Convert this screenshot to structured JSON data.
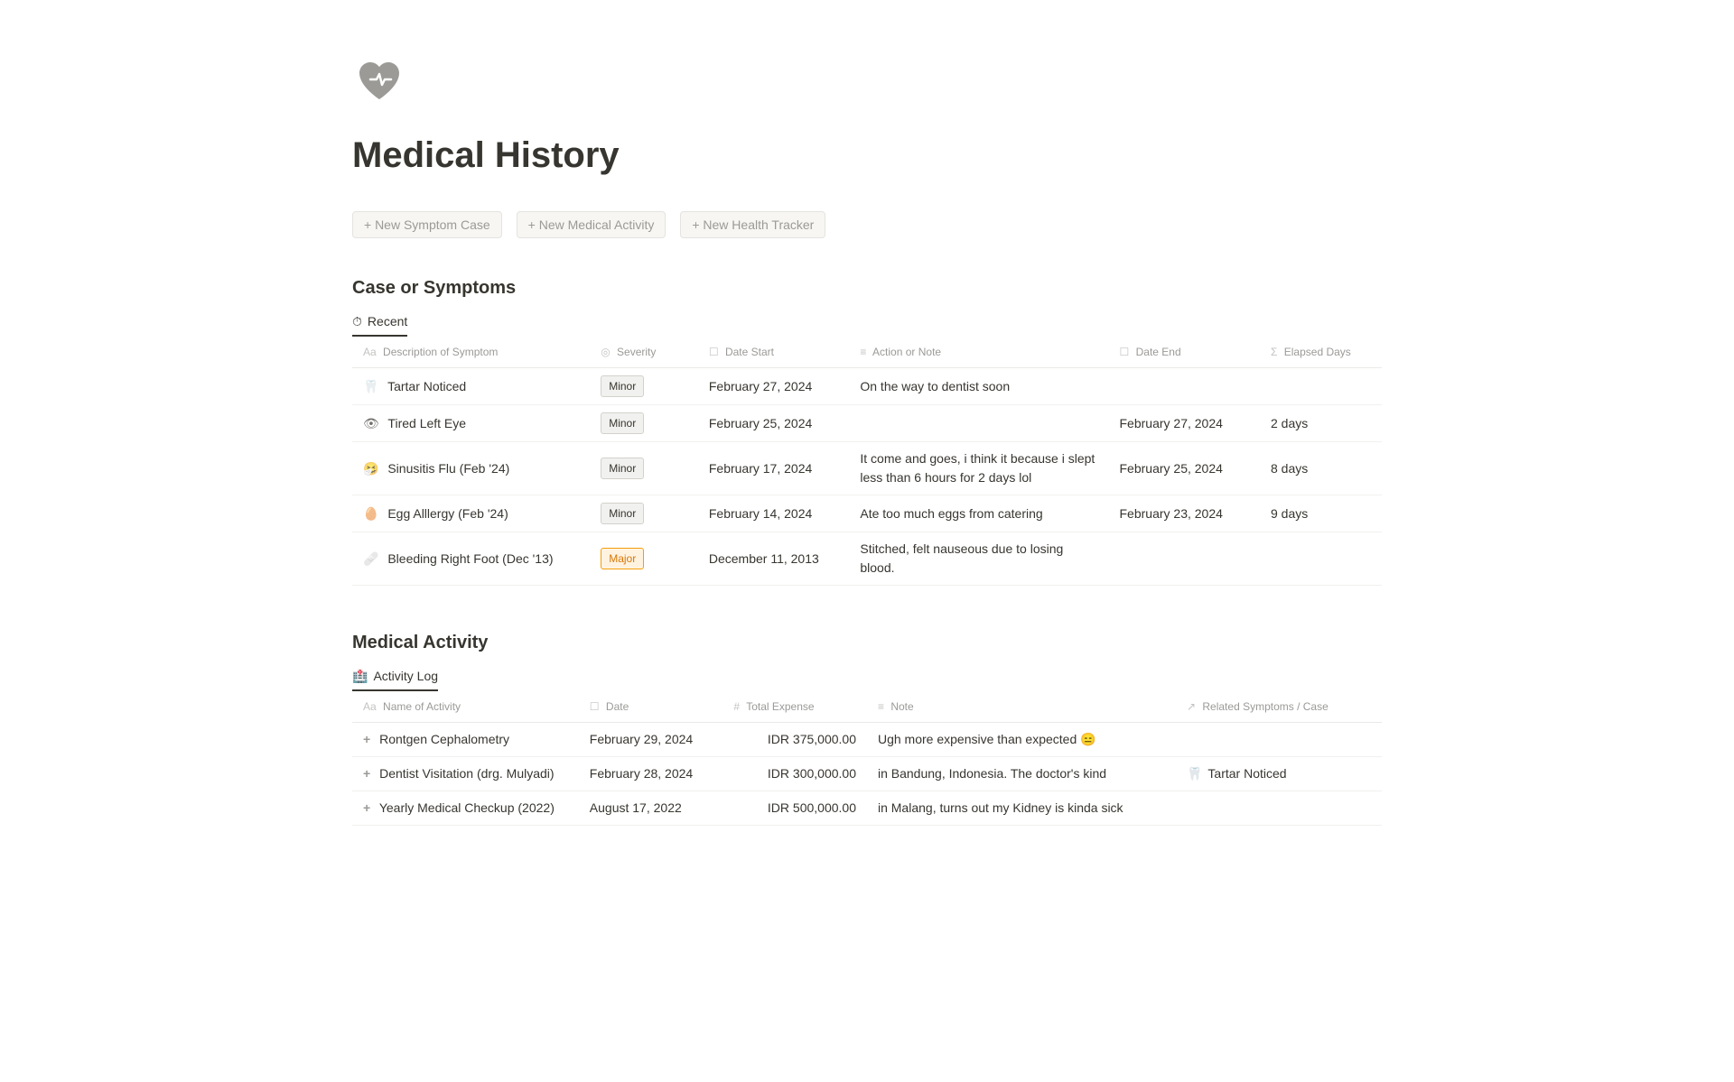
{
  "page": {
    "title": "Medical History",
    "logo_alt": "medical-history-icon"
  },
  "actions": {
    "new_symptom_label": "+ New Symptom Case",
    "new_medical_label": "+ New Medical Activity",
    "new_tracker_label": "+ New Health Tracker"
  },
  "symptoms_section": {
    "title": "Case or Symptoms",
    "tab_label": "Recent",
    "tab_icon": "⏱",
    "columns": [
      {
        "icon": "Aa",
        "label": "Description of Symptom"
      },
      {
        "icon": "◎",
        "label": "Severity"
      },
      {
        "icon": "☐",
        "label": "Date Start"
      },
      {
        "icon": "≡",
        "label": "Action or Note"
      },
      {
        "icon": "☐",
        "label": "Date End"
      },
      {
        "icon": "Σ",
        "label": "Elapsed Days"
      }
    ],
    "rows": [
      {
        "icon": "🦷",
        "description": "Tartar Noticed",
        "severity": "Minor",
        "severity_type": "minor",
        "date_start": "February 27, 2024",
        "action_note": "On the way to dentist soon",
        "date_end": "",
        "elapsed_days": ""
      },
      {
        "icon": "👁",
        "description": "Tired Left Eye",
        "severity": "Minor",
        "severity_type": "minor",
        "date_start": "February 25, 2024",
        "action_note": "",
        "date_end": "February 27, 2024",
        "elapsed_days": "2 days"
      },
      {
        "icon": "🤧",
        "description": "Sinusitis Flu (Feb '24)",
        "severity": "Minor",
        "severity_type": "minor",
        "date_start": "February 17, 2024",
        "action_note": "It come and goes, i think it because i slept less than 6 hours for 2 days lol",
        "date_end": "February 25, 2024",
        "elapsed_days": "8 days"
      },
      {
        "icon": "🥚",
        "description": "Egg Alllergy (Feb '24)",
        "severity": "Minor",
        "severity_type": "minor",
        "date_start": "February 14, 2024",
        "action_note": "Ate too much eggs from catering",
        "date_end": "February 23, 2024",
        "elapsed_days": "9 days"
      },
      {
        "icon": "🩹",
        "description": "Bleeding Right Foot (Dec '13)",
        "severity": "Major",
        "severity_type": "major",
        "date_start": "December 11, 2013",
        "action_note": "Stitched, felt nauseous due to losing blood.",
        "date_end": "",
        "elapsed_days": ""
      }
    ]
  },
  "activity_section": {
    "title": "Medical Activity",
    "tab_label": "Activity Log",
    "tab_icon": "🏥",
    "columns": [
      {
        "icon": "Aa",
        "label": "Name of Activity"
      },
      {
        "icon": "☐",
        "label": "Date"
      },
      {
        "icon": "#",
        "label": "Total Expense"
      },
      {
        "icon": "≡",
        "label": "Note"
      },
      {
        "icon": "↗",
        "label": "Related Symptoms / Case"
      }
    ],
    "rows": [
      {
        "icon": "+",
        "name": "Rontgen Cephalometry",
        "date": "February 29, 2024",
        "expense": "IDR 375,000.00",
        "note": "Ugh more expensive than expected 😑",
        "related": ""
      },
      {
        "icon": "+",
        "name": "Dentist Visitation (drg. Mulyadi)",
        "date": "February 28, 2024",
        "expense": "IDR 300,000.00",
        "note": "in Bandung, Indonesia. The doctor's kind",
        "related": "Tartar Noticed",
        "related_icon": "🦷"
      },
      {
        "icon": "+",
        "name": "Yearly Medical Checkup (2022)",
        "date": "August 17, 2022",
        "expense": "IDR 500,000.00",
        "note": "in Malang, turns out my Kidney is kinda sick",
        "related": ""
      }
    ]
  }
}
